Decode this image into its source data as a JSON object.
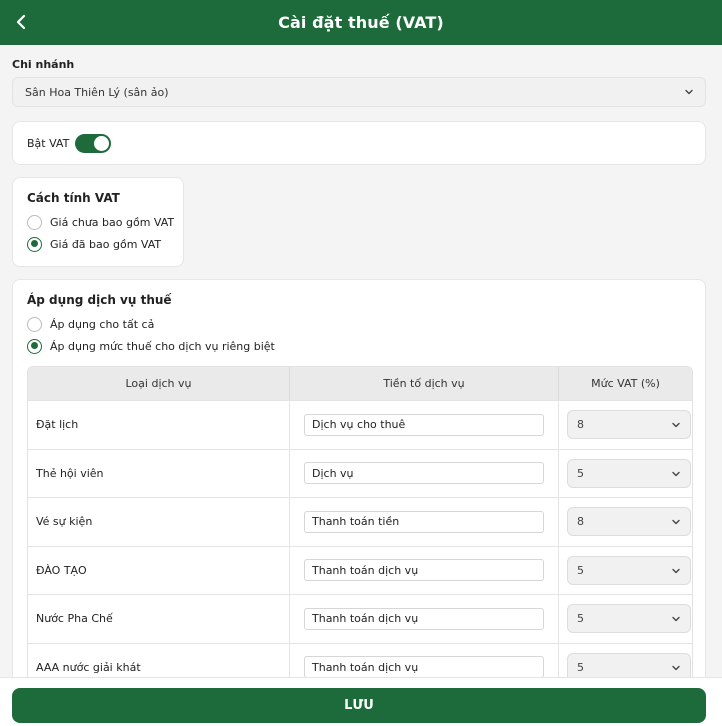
{
  "header": {
    "title": "Cài đặt thuế (VAT)"
  },
  "branch": {
    "label": "Chi nhánh",
    "value": "Sân Hoa Thiên Lý (sân ảo)"
  },
  "vat_toggle": {
    "label": "Bật VAT",
    "on": true
  },
  "calc_method": {
    "title": "Cách tính VAT",
    "options": [
      {
        "label": "Giá chưa bao gồm VAT",
        "selected": false
      },
      {
        "label": "Giá đã bao gồm VAT",
        "selected": true
      }
    ]
  },
  "apply": {
    "title": "Áp dụng dịch vụ thuế",
    "options": [
      {
        "label": "Áp dụng cho tất cả",
        "selected": false
      },
      {
        "label": "Áp dụng mức thuế cho dịch vụ riêng biệt",
        "selected": true
      }
    ],
    "table": {
      "headers": [
        "Loại dịch vụ",
        "Tiền tố dịch vụ",
        "Mức VAT (%)"
      ],
      "rows": [
        {
          "service": "Đặt lịch",
          "prefix": "Dịch vụ cho thuê",
          "vat": "8"
        },
        {
          "service": "Thẻ hội viên",
          "prefix": "Dịch vụ",
          "vat": "5"
        },
        {
          "service": "Vé sự kiện",
          "prefix": "Thanh toán tiền",
          "vat": "8"
        },
        {
          "service": "ĐÀO TẠO",
          "prefix": "Thanh toán dịch vụ",
          "vat": "5"
        },
        {
          "service": "Nước Pha Chế",
          "prefix": "Thanh toán dịch vụ",
          "vat": "5"
        },
        {
          "service": "AAA nước giải khát",
          "prefix": "Thanh toán dịch vụ",
          "vat": "5"
        }
      ]
    }
  },
  "footer": {
    "save_label": "LƯU"
  },
  "colors": {
    "primary": "#1d6a3b",
    "background": "#f4f4f4"
  },
  "icons": {
    "back": "chevron-left-icon",
    "dropdown": "chevron-down-icon"
  }
}
